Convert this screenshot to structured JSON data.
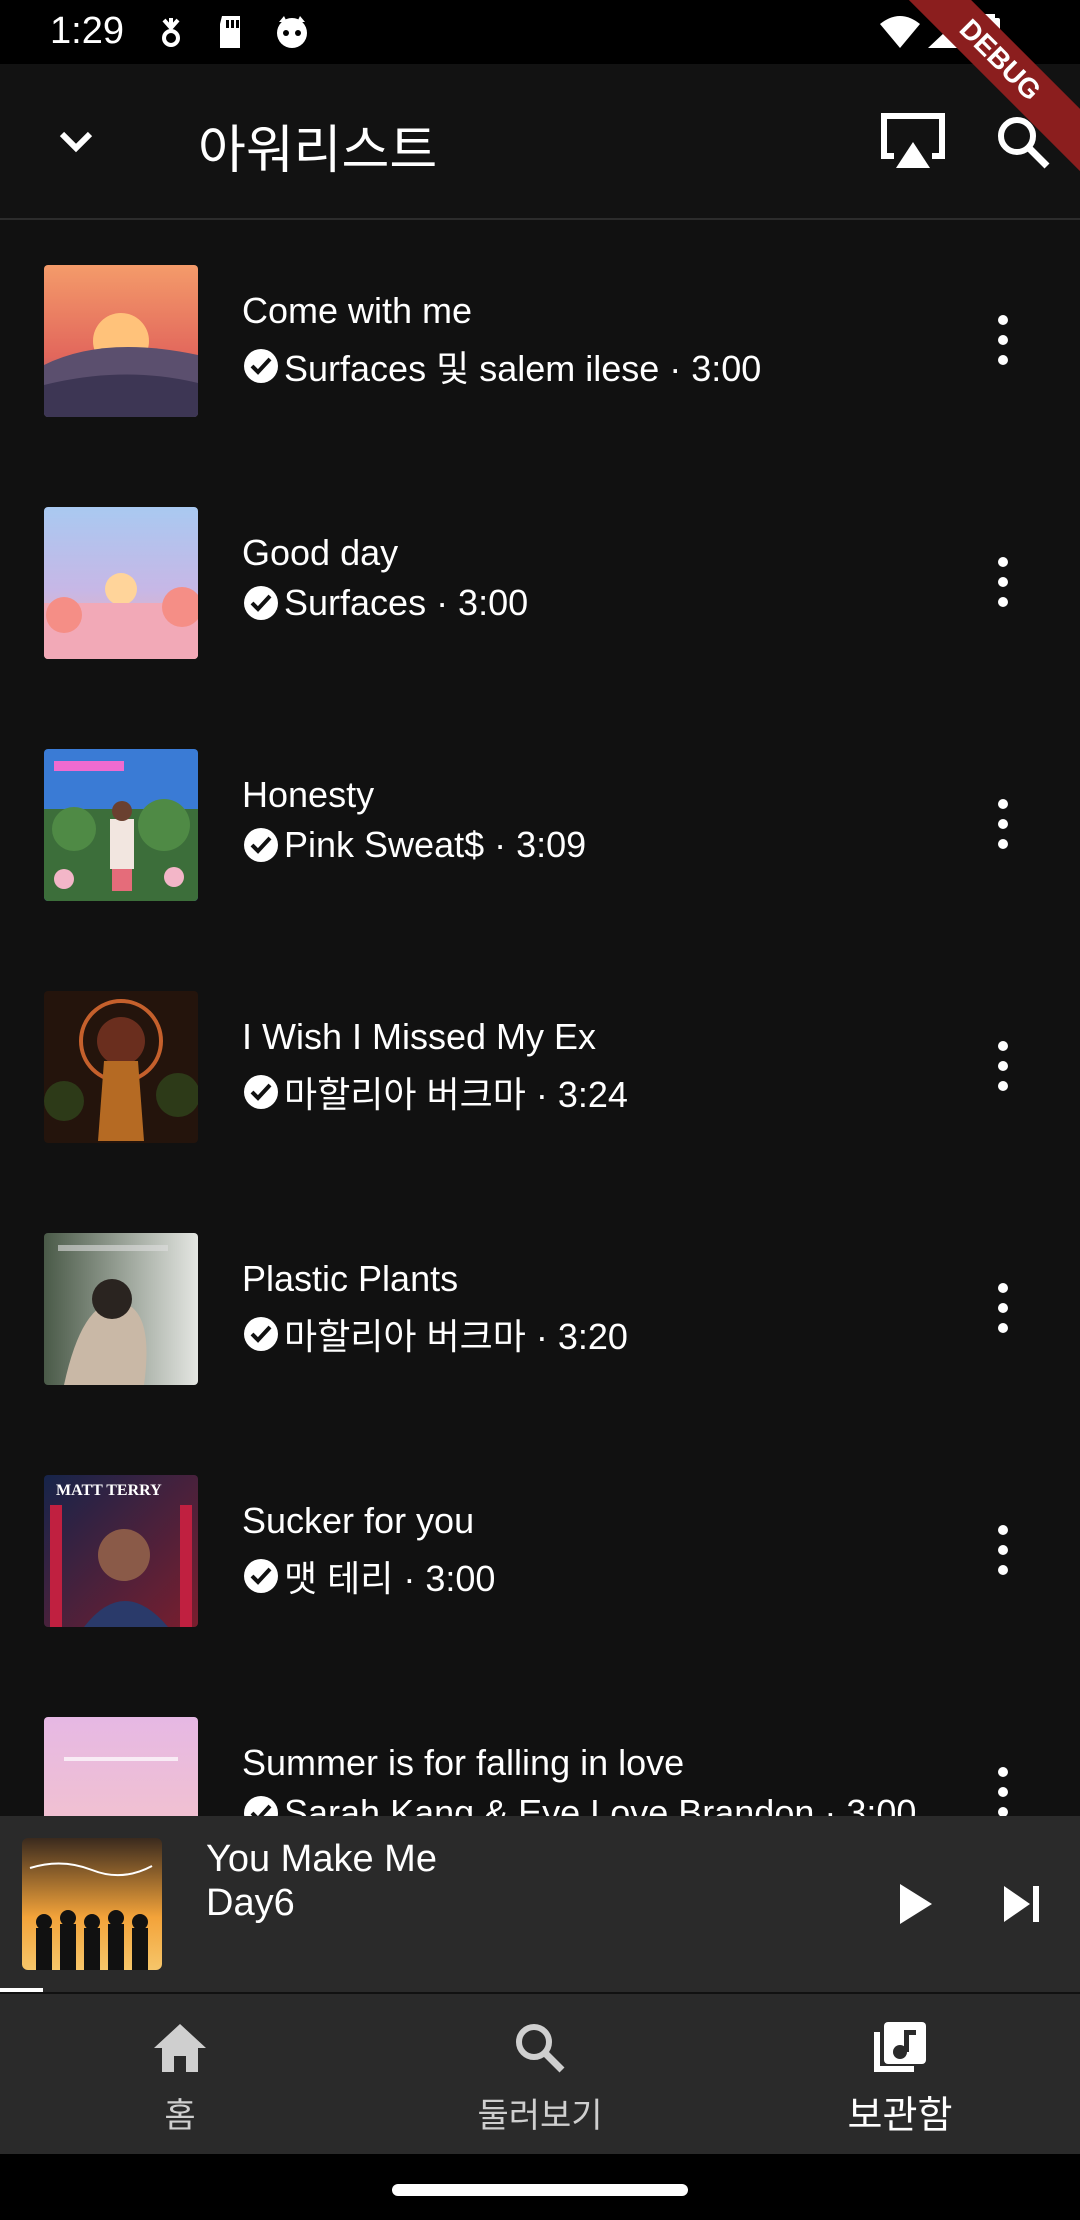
{
  "status_bar": {
    "time": "1:29",
    "badge": "DEBUG"
  },
  "app_bar": {
    "title": "아워리스트"
  },
  "songs": [
    {
      "title": "Come with me",
      "subtitle": "Surfaces 및 salem ilese · 3:00",
      "art_colors": [
        "#f08a5d",
        "#6c5b7b"
      ]
    },
    {
      "title": "Good day",
      "subtitle": "Surfaces · 3:00",
      "art_colors": [
        "#a8c8f0",
        "#f7b6a8"
      ]
    },
    {
      "title": "Honesty",
      "subtitle": "Pink Sweat$ · 3:09",
      "art_colors": [
        "#3a7bd5",
        "#3c6e3a"
      ]
    },
    {
      "title": "I Wish I Missed My Ex",
      "subtitle": "마할리아 버크마 · 3:24",
      "art_colors": [
        "#3a1e10",
        "#6a2e1e"
      ]
    },
    {
      "title": "Plastic Plants",
      "subtitle": "마할리아 버크마 · 3:20",
      "art_colors": [
        "#5a6a5a",
        "#d8dcd8"
      ]
    },
    {
      "title": "Sucker for you",
      "subtitle": "맷 테리 · 3:00",
      "art_colors": [
        "#1c2f5a",
        "#7a1e2e"
      ],
      "art_text": "MATT TERRY"
    },
    {
      "title": "Summer is for falling in love",
      "subtitle": "Sarah Kang & Eye Love Brandon · 3:00",
      "art_colors": [
        "#f2c7d8",
        "#e8b0d0"
      ]
    }
  ],
  "now_playing": {
    "title": "You Make Me",
    "artist": "Day6",
    "progress": 0.04
  },
  "bottom_nav": [
    {
      "label": "홈",
      "icon": "home-icon",
      "active": false
    },
    {
      "label": "둘러보기",
      "icon": "explore-search-icon",
      "active": false
    },
    {
      "label": "보관함",
      "icon": "library-music-icon",
      "active": true
    }
  ]
}
